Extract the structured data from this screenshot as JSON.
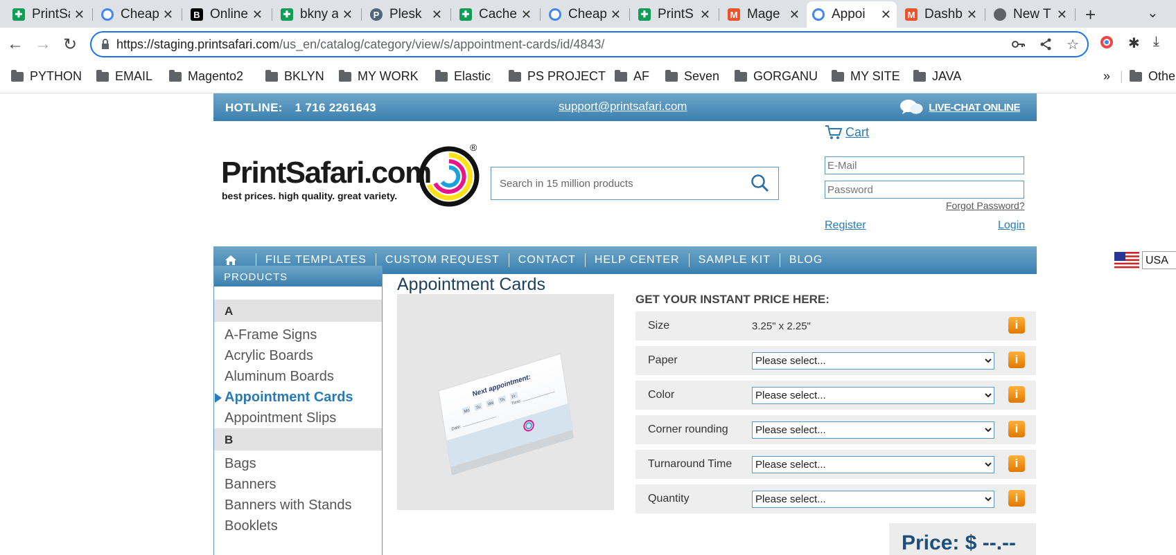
{
  "browser": {
    "tabs": [
      {
        "title": "PrintSafari",
        "icon": "sheets-icon",
        "color": "#0f9d58"
      },
      {
        "title": "Cheap",
        "icon": "chrome-ring-icon",
        "color": "#4285f4"
      },
      {
        "title": "Online",
        "icon": "b-logo-icon",
        "color": "#000000"
      },
      {
        "title": "bkny a",
        "icon": "sheets-icon",
        "color": "#0f9d58"
      },
      {
        "title": "Plesk",
        "icon": "plesk-icon",
        "color": "#52667b"
      },
      {
        "title": "Cache",
        "icon": "sheets-icon",
        "color": "#0f9d58"
      },
      {
        "title": "Cheap",
        "icon": "chrome-ring-icon",
        "color": "#4285f4"
      },
      {
        "title": "PrintS",
        "icon": "sheets-icon",
        "color": "#0f9d58"
      },
      {
        "title": "Mage",
        "icon": "magento-icon",
        "color": "#e9542d"
      },
      {
        "title": "Appoi",
        "icon": "chrome-ring-icon",
        "color": "#4285f4",
        "active": true
      },
      {
        "title": "Dashb",
        "icon": "magento-icon",
        "color": "#e9542d"
      },
      {
        "title": "New T",
        "icon": "chrome-icon",
        "color": "#5f6368"
      }
    ],
    "url_host": "https://staging.printsafari.com",
    "url_path": "/us_en/catalog/category/view/s/appointment-cards/id/4843/",
    "bookmarks": [
      "PYTHON",
      "EMAIL",
      "Magento2",
      "BKLYN",
      "MY WORK",
      "Elastic",
      "PS PROJECT",
      "AF",
      "Seven",
      "GORGANU",
      "MY SITE",
      "JAVA"
    ],
    "bookmarks_overflow": "»",
    "other_bookmarks": "Othe"
  },
  "site": {
    "hotline_label": "HOTLINE:",
    "hotline_number": "1 716 2261643",
    "support_email": "support@printsafari.com",
    "live_chat": "LIVE-CHAT ONLINE",
    "logo_text": "PrintSafari.com",
    "logo_tagline": "best prices. high quality. great variety.",
    "search_placeholder": "Search in 15 million products",
    "cart_label": "Cart",
    "email_placeholder": "E-Mail",
    "password_placeholder": "Password",
    "forgot_password": "Forgot Password?",
    "register": "Register",
    "login": "Login",
    "nav": [
      "FILE TEMPLATES",
      "CUSTOM REQUEST",
      "CONTACT",
      "HELP CENTER",
      "SAMPLE KIT",
      "BLOG"
    ],
    "country": "USA"
  },
  "sidebar": {
    "heading": "PRODUCTS",
    "groups": [
      {
        "letter": "A",
        "items": [
          "A-Frame Signs",
          "Acrylic Boards",
          "Aluminum Boards",
          "Appointment Cards",
          "Appointment Slips"
        ]
      },
      {
        "letter": "B",
        "items": [
          "Bags",
          "Banners",
          "Banners with Stands",
          "Booklets"
        ]
      }
    ],
    "active_item": "Appointment Cards"
  },
  "product": {
    "title": "Appointment Cards",
    "image_text": {
      "heading": "Next appointment:",
      "days": [
        "Mo",
        "Tu",
        "We",
        "Th",
        "Fr"
      ],
      "date_label": "Date:",
      "time_label": "Time:"
    }
  },
  "price": {
    "heading": "GET YOUR INSTANT PRICE HERE:",
    "size_label": "Size",
    "size_value": "3.25\" x 2.25\"",
    "options": [
      {
        "label": "Paper",
        "value": "Please select..."
      },
      {
        "label": "Color",
        "value": "Please select..."
      },
      {
        "label": "Corner rounding",
        "value": "Please select..."
      },
      {
        "label": "Turnaround Time",
        "value": "Please select..."
      },
      {
        "label": "Quantity",
        "value": "Please select..."
      }
    ],
    "info_glyph": "i",
    "price_text": "Price: $ --.--"
  }
}
